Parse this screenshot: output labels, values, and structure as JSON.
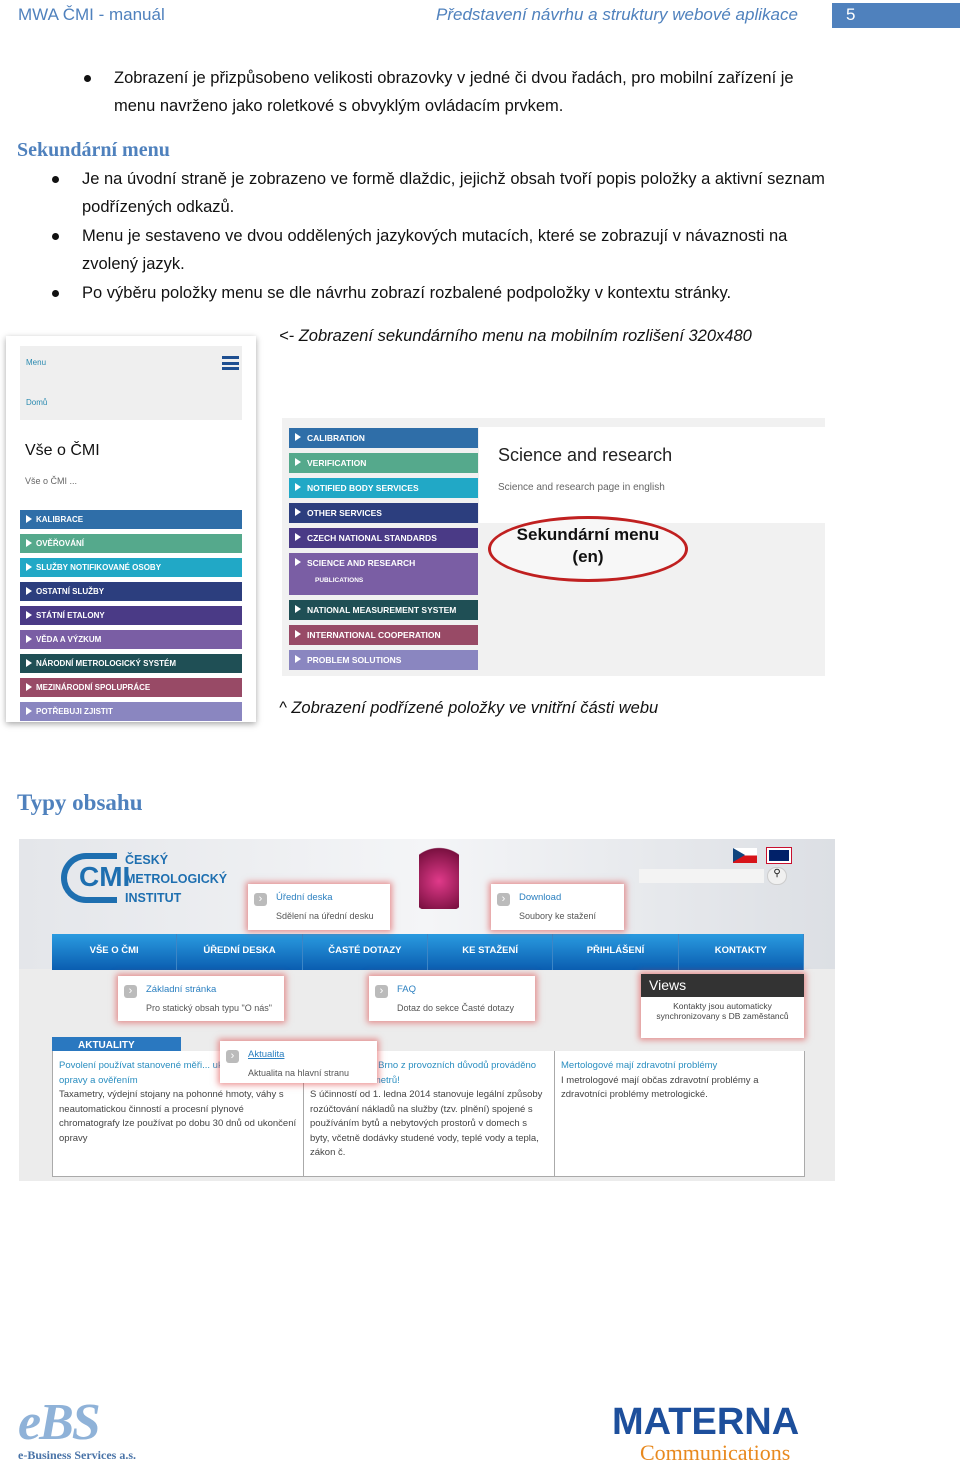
{
  "header": {
    "title": "MWA ČMI - manuál",
    "chapter": "Představení návrhu a struktury webové aplikace",
    "page": "5"
  },
  "intro_bullet": "Zobrazení je přizpůsobeno velikosti obrazovky v jedné či dvou řadách, pro mobilní zařízení je menu navrženo jako roletkové s obvyklým ovládacím prvkem.",
  "section1": {
    "heading": "Sekundární menu",
    "bullets": [
      "Je na úvodní straně je zobrazeno ve formě dlaždic, jejichž obsah tvoří  popis položky a aktivní seznam podřízených odkazů.",
      "Menu je sestaveno ve dvou oddělených jazykových mutacích, které se zobrazují v návaznosti na zvolený jazyk.",
      "Po výběru položky menu se dle návrhu zobrazí rozbalené podpoložky v kontextu stránky."
    ]
  },
  "captions": {
    "mobile": "<- Zobrazení sekundárního menu na mobilním rozlišení 320x480",
    "sub": "^ Zobrazení podřízené položky ve vnitřní části webu"
  },
  "mobile": {
    "menu": "Menu",
    "home": "Domů",
    "title": "Vše o ČMI",
    "desc": "Vše o ČMI ...",
    "items": [
      {
        "label": "KALIBRACE",
        "color": "#2f6ea8"
      },
      {
        "label": "OVĚŘOVÁNÍ",
        "color": "#55a98c"
      },
      {
        "label": "SLUŽBY NOTIFIKOVANÉ OSOBY",
        "color": "#21a8c6"
      },
      {
        "label": "OSTATNÍ SLUŽBY",
        "color": "#2c3e7e"
      },
      {
        "label": "STÁTNÍ ETALONY",
        "color": "#4a3a86"
      },
      {
        "label": "VĚDA A VÝZKUM",
        "color": "#7a5ea4"
      },
      {
        "label": "NÁRODNÍ METROLOGICKÝ SYSTÉM",
        "color": "#1f4f55"
      },
      {
        "label": "MEZINÁRODNÍ SPOLUPRÁCE",
        "color": "#984a66"
      },
      {
        "label": "POTŘEBUJI ZJISTIT",
        "color": "#8a86c0"
      }
    ]
  },
  "secondary": {
    "title": "Science and research",
    "desc": "Science and research page in english",
    "bubble1": "Sekundární menu",
    "bubble2": "(en)",
    "sub_item": "PUBLICATIONS",
    "items": [
      {
        "label": "CALIBRATION",
        "color": "#2f6ea8"
      },
      {
        "label": "VERIFICATION",
        "color": "#55a98c"
      },
      {
        "label": "NOTIFIED BODY SERVICES",
        "color": "#21a8c6"
      },
      {
        "label": "OTHER SERVICES",
        "color": "#2c3e7e"
      },
      {
        "label": "CZECH NATIONAL STANDARDS",
        "color": "#4a3a86"
      },
      {
        "label": "SCIENCE AND RESEARCH",
        "color": "#7a5ea4"
      },
      {
        "label": "NATIONAL MEASUREMENT SYSTEM",
        "color": "#1f4f55"
      },
      {
        "label": "INTERNATIONAL COOPERATION",
        "color": "#984a66"
      },
      {
        "label": "PROBLEM SOLUTIONS",
        "color": "#8a86c0"
      }
    ]
  },
  "section2": {
    "heading": "Typy obsahu"
  },
  "website": {
    "logo": [
      "ČESKÝ",
      "METROLOGICKÝ",
      "INSTITUT"
    ],
    "logo_mark": "CMI",
    "nav": [
      "VŠE O ČMI",
      "ÚŘEDNÍ DESKA",
      "ČASTÉ DOTAZY",
      "KE STAŽENÍ",
      "PŘIHLÁŠENÍ",
      "KONTAKTY"
    ],
    "tiles": [
      {
        "title": "Úřední deska",
        "desc": "Sdělení na úřední desku"
      },
      {
        "title": "Download",
        "desc": "Soubory ke stažení"
      },
      {
        "title": "Základní stránka",
        "desc": "Pro statický obsah typu \"O nás\""
      },
      {
        "title": "FAQ",
        "desc": "Dotaz do sekce Časté dotazy"
      },
      {
        "title": "Aktualita",
        "desc": "Aktualita na hlavní stranu"
      }
    ],
    "views": {
      "title": "Views",
      "desc": "Kontakty jsou automaticky synchronizovany s DB zaměstanců"
    },
    "news_tab": "AKTUALITY",
    "news": [
      {
        "link": "Povolení používat stanovené měři... ukončením jeho opravy a ověřením",
        "text": "Taxametry, výdejní stojany na pohonné hmoty, váhy s neautomatickou činností a procesní plynové chromatografy lze používat po dobu 30 dnů od ukončení opravy"
      },
      {
        "link": "...nebude na OI Brno z provozních důvodů prováděno ověřování tonometrů!",
        "text": "S účinností od 1. ledna 2014 stanovuje legální způsoby rozúčtování nákladů na služby (tzv. plnění) spojené s používáním bytů a nebytových prostorů v domech s byty, včetně dodávky studené vody, teplé vody a tepla, zákon č."
      },
      {
        "link": "Mertologové mají zdravotní problémy",
        "text": "I metrologové mají občas zdravotní problémy a zdravotníci problémy metrologické."
      }
    ]
  },
  "footer": {
    "left_logo": "eBS",
    "left_sub": "e-Business Services a.s.",
    "right_logo": "MATERNA",
    "right_sub": "Communications"
  }
}
